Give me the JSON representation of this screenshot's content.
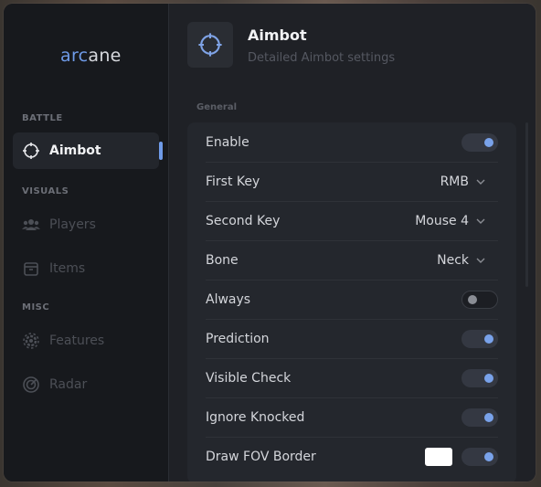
{
  "app": {
    "logo_accent": "arc",
    "logo_rest": "ane"
  },
  "sidebar": {
    "sections": [
      {
        "label": "BATTLE"
      },
      {
        "label": "VISUALS"
      },
      {
        "label": "MISC"
      }
    ],
    "items": [
      {
        "label": "Aimbot",
        "icon": "crosshair-icon",
        "active": true
      },
      {
        "label": "Players",
        "icon": "players-icon",
        "active": false
      },
      {
        "label": "Items",
        "icon": "items-icon",
        "active": false
      },
      {
        "label": "Features",
        "icon": "gear-icon",
        "active": false
      },
      {
        "label": "Radar",
        "icon": "radar-icon",
        "active": false
      }
    ]
  },
  "header": {
    "title": "Aimbot",
    "subtitle": "Detailed Aimbot settings"
  },
  "group": {
    "label": "General"
  },
  "settings": [
    {
      "label": "Enable",
      "type": "toggle",
      "value": true
    },
    {
      "label": "First Key",
      "type": "select",
      "value": "RMB"
    },
    {
      "label": "Second Key",
      "type": "select",
      "value": "Mouse 4"
    },
    {
      "label": "Bone",
      "type": "select",
      "value": "Neck"
    },
    {
      "label": "Always",
      "type": "toggle",
      "value": false
    },
    {
      "label": "Prediction",
      "type": "toggle",
      "value": true
    },
    {
      "label": "Visible Check",
      "type": "toggle",
      "value": true
    },
    {
      "label": "Ignore Knocked",
      "type": "toggle",
      "value": true
    },
    {
      "label": "Draw FOV Border",
      "type": "toggle_color",
      "value": true,
      "color": "#ffffff"
    }
  ],
  "colors": {
    "accent": "#6f9be8",
    "background": "#1f2126"
  }
}
